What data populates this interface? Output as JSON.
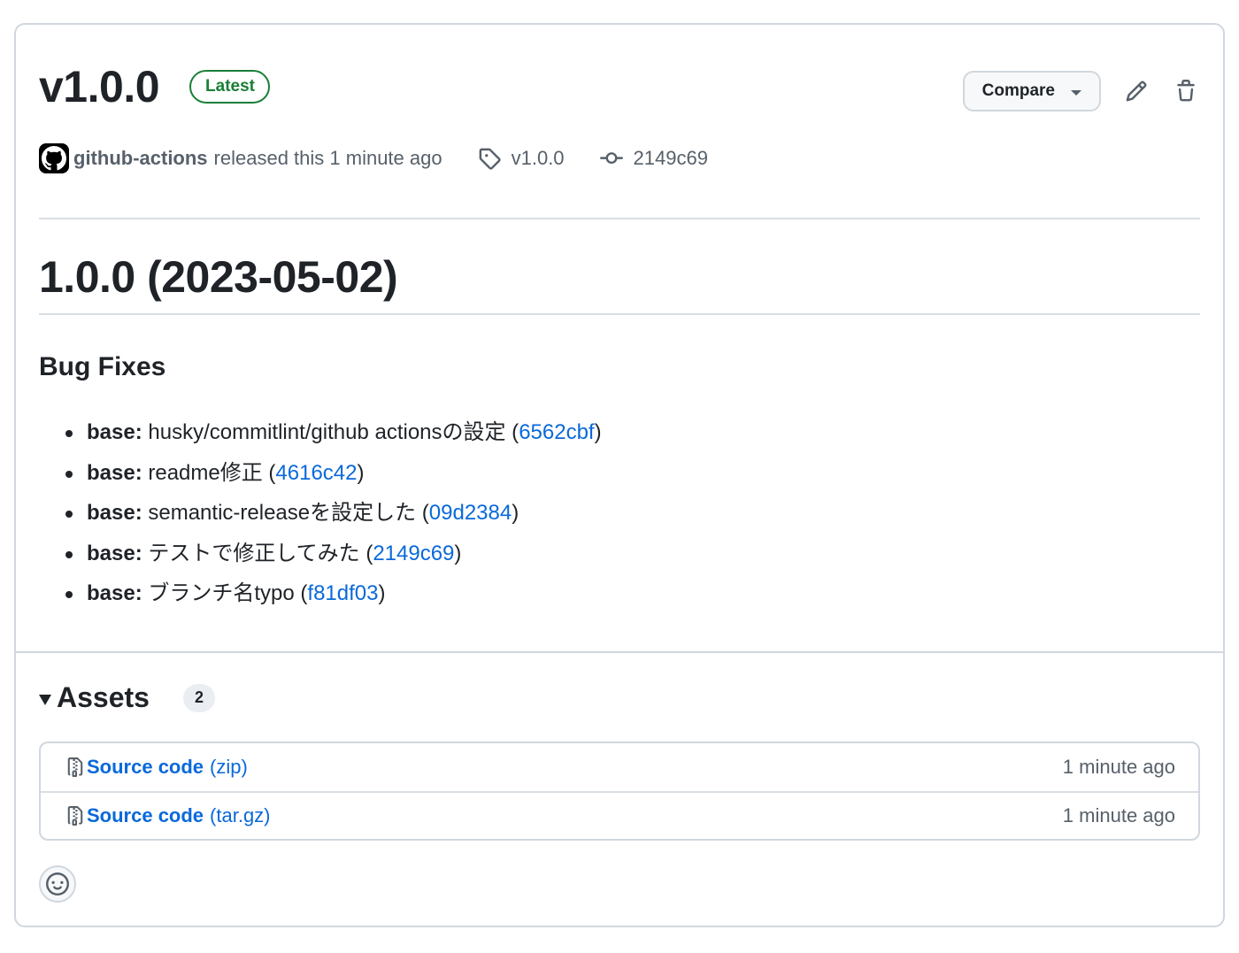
{
  "release": {
    "version": "v1.0.0",
    "latest_badge": "Latest",
    "compare_label": "Compare",
    "author": "github-actions",
    "released_text": "released this 1 minute ago",
    "tag": "v1.0.0",
    "commit": "2149c69"
  },
  "notes": {
    "heading": "1.0.0 (2023-05-02)",
    "section_title": "Bug Fixes",
    "items": [
      {
        "scope": "base:",
        "text": " husky/commitlint/github actionsの設定 (",
        "hash": "6562cbf",
        "close": ")"
      },
      {
        "scope": "base:",
        "text": " readme修正 (",
        "hash": "4616c42",
        "close": ")"
      },
      {
        "scope": "base:",
        "text": " semantic-releaseを設定した (",
        "hash": "09d2384",
        "close": ")"
      },
      {
        "scope": "base:",
        "text": " テストで修正してみた (",
        "hash": "2149c69",
        "close": ")"
      },
      {
        "scope": "base:",
        "text": " ブランチ名typo (",
        "hash": "f81df03",
        "close": ")"
      }
    ]
  },
  "assets": {
    "title": "Assets",
    "count": "2",
    "rows": [
      {
        "name": "Source code",
        "ext": "(zip)",
        "time": "1 minute ago"
      },
      {
        "name": "Source code",
        "ext": "(tar.gz)",
        "time": "1 minute ago"
      }
    ]
  },
  "icons": {
    "tag": "tag-icon",
    "commit": "git-commit-icon",
    "edit": "pencil-icon",
    "delete": "trash-icon",
    "zip": "file-zip-icon",
    "emoji": "smiley-icon",
    "avatar": "github-mark-icon"
  },
  "colors": {
    "latest": "#1a7f37",
    "link": "#0969da",
    "muted": "#57606a",
    "border": "#d0d7de"
  }
}
